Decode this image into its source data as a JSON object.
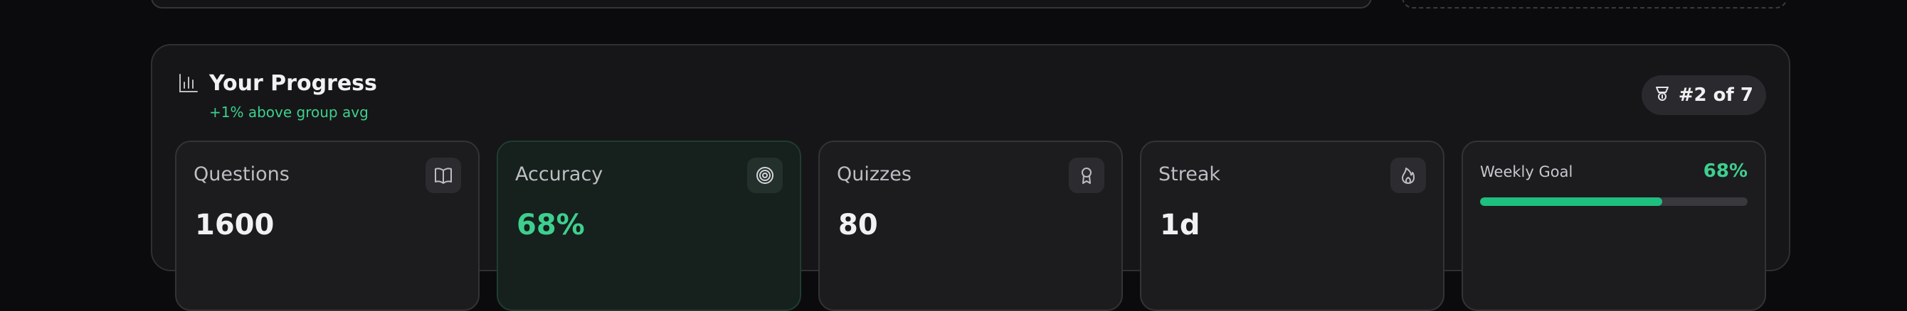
{
  "progress": {
    "title": "Your Progress",
    "subtitle": "+1% above group avg",
    "rank": "#2 of 7",
    "stats": [
      {
        "label": "Questions",
        "value": "1600",
        "icon": "book-icon"
      },
      {
        "label": "Accuracy",
        "value": "68%",
        "icon": "target-icon"
      },
      {
        "label": "Quizzes",
        "value": "80",
        "icon": "award-icon"
      },
      {
        "label": "Streak",
        "value": "1d",
        "icon": "flame-icon"
      }
    ],
    "weekly_goal": {
      "label": "Weekly Goal",
      "percent_text": "68%",
      "progress": 0.68
    },
    "colors": {
      "accent": "#3ecf8e",
      "bar": "#1fbf7f"
    }
  }
}
